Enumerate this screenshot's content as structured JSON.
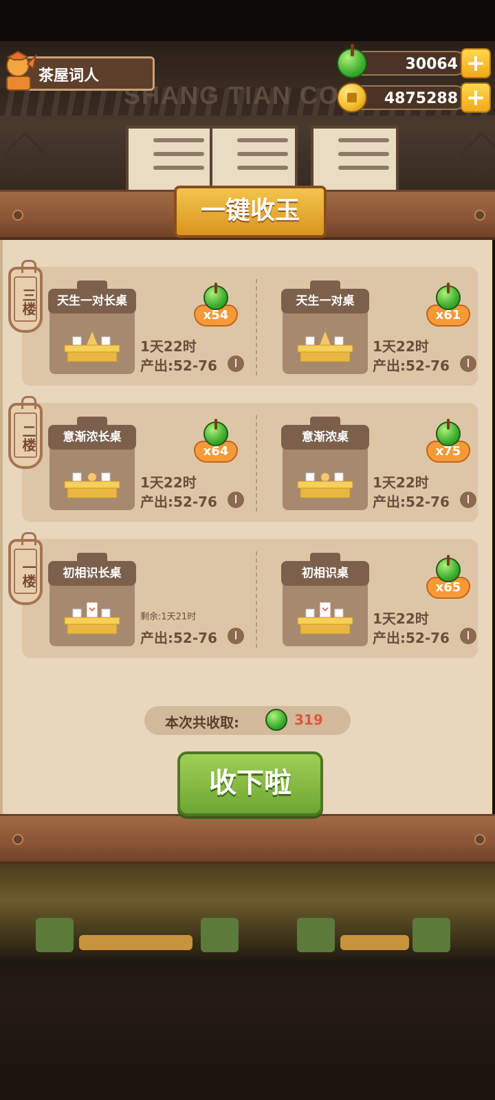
{
  "header": {
    "player_name": "茶屋词人",
    "jade_amount": "30064",
    "coin_amount": "4875288",
    "plus_label": "+",
    "cafe_sign": "SHANG TIAN COF"
  },
  "panel": {
    "title": "一键收玉",
    "floors": [
      {
        "label": "三楼",
        "tables": [
          {
            "name": "天生一对长桌",
            "badge": "x54",
            "time": "1天22时",
            "output": "产出:52-76"
          },
          {
            "name": "天生一对桌",
            "badge": "x61",
            "time": "1天22时",
            "output": "产出:52-76"
          }
        ]
      },
      {
        "label": "二楼",
        "tables": [
          {
            "name": "意渐浓长桌",
            "badge": "x64",
            "time": "1天22时",
            "output": "产出:52-76"
          },
          {
            "name": "意渐浓桌",
            "badge": "x75",
            "time": "1天22时",
            "output": "产出:52-76"
          }
        ]
      },
      {
        "label": "一楼",
        "tables": [
          {
            "name": "初相识长桌",
            "badge": "",
            "remaining": "剩余:1天21时",
            "output": "产出:52-76"
          },
          {
            "name": "初相识桌",
            "badge": "x65",
            "time": "1天22时",
            "output": "产出:52-76"
          }
        ]
      }
    ],
    "total_label": "本次共收取:",
    "total_value": "319",
    "collect_button": "收下啦"
  },
  "colors": {
    "jade": "#3eae2e",
    "badge": "#f59a37",
    "button_green": "#8cc24a",
    "total_value": "#e0553c"
  },
  "icons": [
    "jade-icon",
    "coin-icon",
    "plus-icon",
    "coffee-bean-icon",
    "table-icon",
    "avatar-icon"
  ]
}
